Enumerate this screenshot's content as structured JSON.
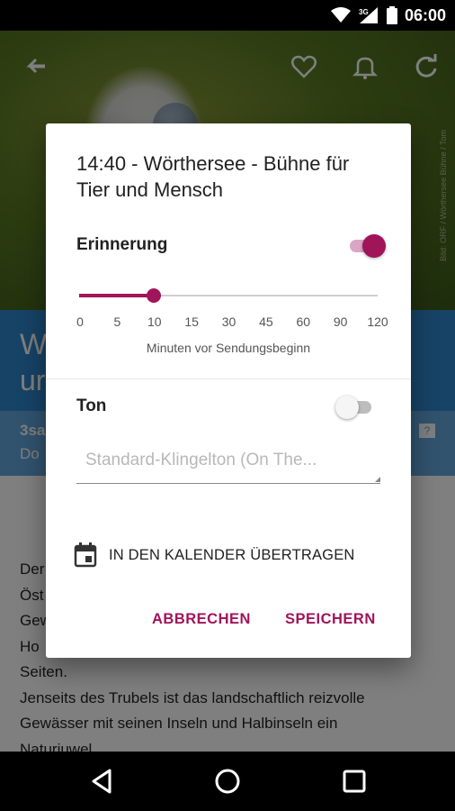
{
  "status_bar": {
    "time": "06:00",
    "network": "3G"
  },
  "hero": {
    "credit": "Bild: ORF / Wörthersee Bühne / Tom"
  },
  "header_icons": [
    "back-arrow-icon",
    "heart-icon",
    "bell-icon",
    "refresh-icon"
  ],
  "background": {
    "title_line1": "W",
    "title_line2": "ur",
    "meta_line1": "3sa",
    "meta_line2": "Do",
    "content_lines": [
      "Der",
      "Öst",
      "Gew",
      "Ho",
      "Seiten.",
      "Jenseits des Trubels ist das landschaftlich reizvolle",
      "Gewässer mit seinen Inseln und Halbinseln ein",
      "Naturjuwel."
    ]
  },
  "dialog": {
    "title": "14:40 - Wörthersee - Bühne für Tier und Mensch",
    "reminder_label": "Erinnerung",
    "reminder_on": true,
    "slider": {
      "ticks": [
        "0",
        "5",
        "10",
        "15",
        "30",
        "45",
        "60",
        "90",
        "120"
      ],
      "selected_value": "10",
      "selected_index": 2,
      "caption": "Minuten vor Sendungsbeginn"
    },
    "sound_label": "Ton",
    "sound_on": false,
    "ringtone_value": "Standard-Klingelton (On The...",
    "calendar_label": "IN DEN KALENDER ÜBERTRAGEN",
    "cancel_label": "ABBRECHEN",
    "save_label": "SPEICHERN"
  },
  "colors": {
    "accent": "#a0145a",
    "title_band": "#2f86cc",
    "meta_band": "#63a6dc"
  }
}
